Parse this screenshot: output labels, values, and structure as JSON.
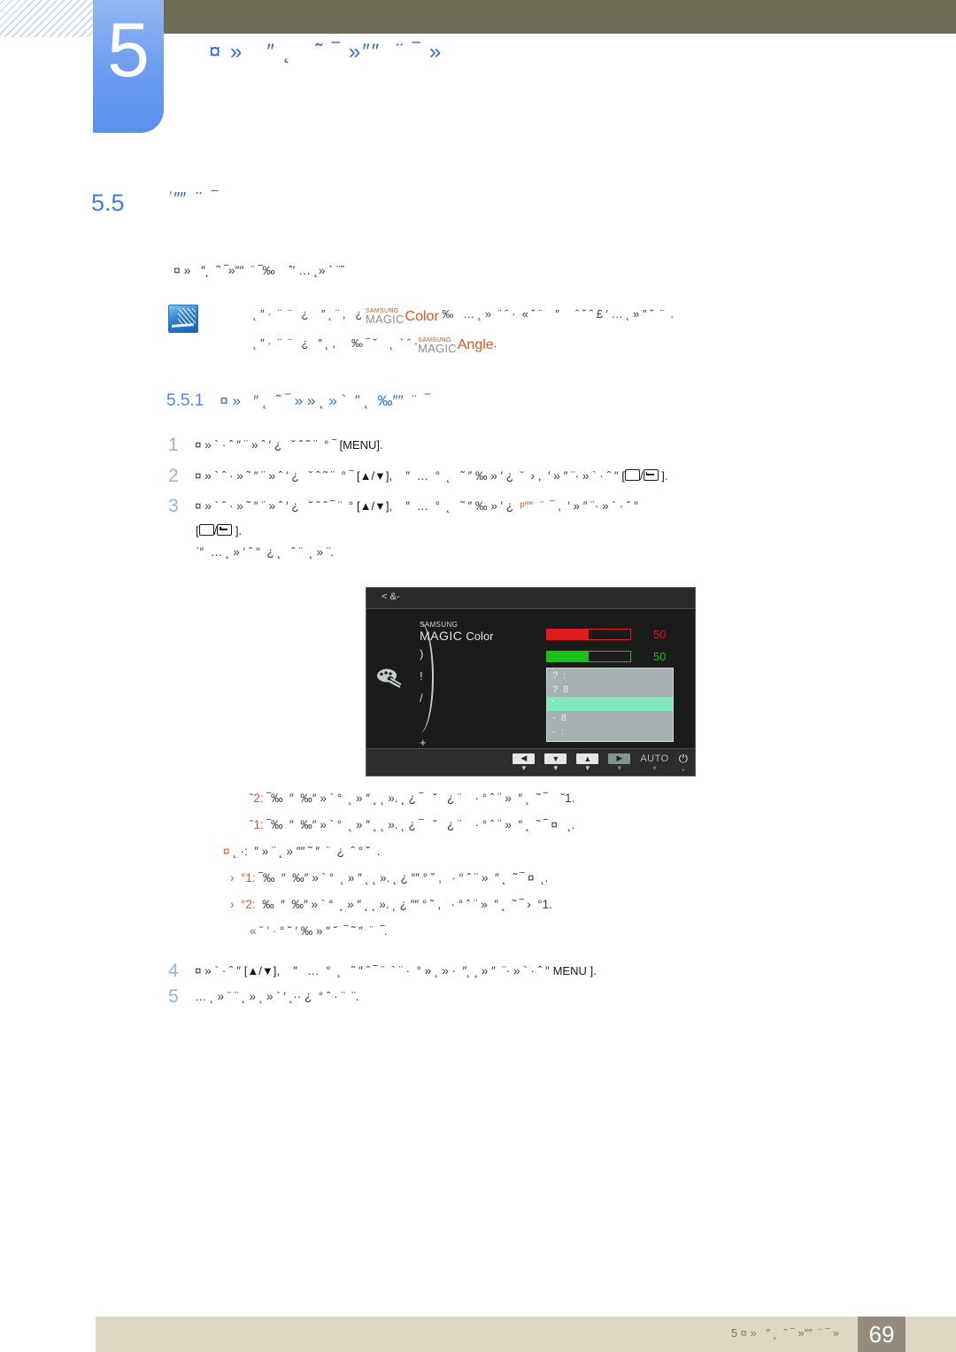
{
  "page": {
    "chapter_number": "5",
    "chapter_title": "¤ »   ″ ˛   ˜ ‾ »″″  ¨ ‾ »",
    "page_number": "69",
    "footer_text": "5 ¤ »   ″ ˛  ˜ ‾ »″″  ¨ ‾ »"
  },
  "section": {
    "number": "5.5",
    "title": "ˈ″″  ¨  ‾",
    "intro": "¤ »   ″˛  ˜ ‾»″″  ¨ ‾‰    ˆ′ … ˛» ` ¨ˆ"
  },
  "note": {
    "icon": "note-pencil-icon",
    "line1_pre": "˛ ″ ·  ¨  ¨   ¿    ″ ˛ ¨ ,   ¿ ",
    "line1_post": " ‰   … ˛ »  ¨ ˆ ·  « ˘ ¨    ″     ˆ ˘ ˆ £ ′ … ˛ » ″ ˘  ¨  .",
    "line2_pre": "˛ ″ ·  ¨  ¨   ¿   ″ ˛ ,     ‰ ‾ ˘    ˛  ` ˆ ·",
    "line2_post": ".",
    "logo1": {
      "top": "SAMSUNG",
      "bottom": "MAGIC",
      "word": "Color"
    },
    "logo2": {
      "top": "SAMSUNG",
      "bottom": "MAGIC",
      "word": "Angle"
    }
  },
  "subsection": {
    "number": "5.5.1",
    "title": "¤ »   ″ ˛  ˜ ‾ » » ˛ » `  ″ ˛  ‰″″  ¨  ‾"
  },
  "steps": [
    {
      "number": "1",
      "text_pre": "¤ » ` · ˆ ″ ¨ » ˆ ′ ¿   ˘ ˆ ˜ ¨  ° ‾ ",
      "key": "[MENU]",
      "text_post": "."
    },
    {
      "number": "2",
      "text_pre": "¤ » ` ˆ · » ˜ ″ ¨ » ˆ ′ ¿   ˘ ˆ ˜ ¨  ° ‾ ",
      "key1": "[▲/▼]",
      "text_mid": ",    ″  …  °  ˛   ˜ ″ ‰ » ′ ¿  ",
      "highlight": "˘",
      "text_mid2": "  › ,  ′ » ″ ¨· » ` · ˆ ″ ",
      "key2": "[▭/↵]",
      "text_post": "."
    },
    {
      "number": "3",
      "text_pre": "¤ » ` ˆ · » ˜ ″ ¨ » ˆ ′ ¿   ˘ ˆ ˆ ‾ ¨  ° ",
      "key1": "[▲/▼]",
      "text_mid": ",    ″  …  °  ˛   ˜ ″ ‰ » ′ ¿  ",
      "highlight": "ᵖ″″  ¨  ‾",
      "text_mid2": " ,  ′ » ″ ¨· » ` · ˆ ″",
      "key2": "[▭/↵]",
      "text_post": ".",
      "extra": "ˈ″  … ˛ » ′ ˆ ″  ¿ ˛   ˆ ¨  ˛ » ¨."
    },
    {
      "number": "4",
      "text_pre": "¤ » ` · ˆ ″ ",
      "key1": "[▲/▼]",
      "text_mid": ",    ″   …  °  ˛   ˜ ″ ˆ ‾ ¨  ` ¨ ·  ° » ˛ » ·  ″˛ ¸ » ″  ¨· » ` · ˆ ″ ",
      "key2": "MENU ]",
      "text_post": "."
    },
    {
      "number": "5",
      "text_pre": "… ˛ » ¨ ¨ ˛ » ˛ » ` ′ ˛·· ¿  ° ˆ · ¨  ¨."
    }
  ],
  "osd": {
    "titlebar": "< &-",
    "logo": {
      "top": "SAMSUNG",
      "bottom": "MAGIC",
      "word": "Color"
    },
    "menu_items": [
      ")",
      "!",
      "/",
      "+"
    ],
    "palette_icon": "palette-icon",
    "bars": [
      {
        "label": "red-bar",
        "value": "50",
        "percent": 50,
        "color": "#e01b1b"
      },
      {
        "label": "green-bar",
        "value": "50",
        "percent": 50,
        "color": "#18c018"
      }
    ],
    "dropdown_rows": [
      {
        "text": "?  :",
        "selected": false
      },
      {
        "text": "?  8",
        "selected": false
      },
      {
        "text": "'",
        "selected": true
      },
      {
        "text": "-  8",
        "selected": false
      },
      {
        "text": "-  :",
        "selected": false
      }
    ],
    "buttons": [
      {
        "name": "left-arrow-button",
        "glyph": "◀",
        "tick": "▼"
      },
      {
        "name": "down-arrow-button",
        "glyph": "▼",
        "tick": "▼"
      },
      {
        "name": "up-arrow-button",
        "glyph": "▲",
        "tick": "▼"
      },
      {
        "name": "right-arrow-button",
        "glyph": "▶",
        "tick": "▼"
      },
      {
        "name": "auto-button",
        "glyph": "AUTO",
        "tick": "▾"
      },
      {
        "name": "power-button",
        "glyph": "⏻",
        "tick": "▪"
      }
    ]
  },
  "bullets": [
    {
      "lead": "˘2:",
      "text": " ‾‰  ″  ‰″ » ` °  ˛ » ″ ˛ ˛ ». ˛ ¿ ‾   ˘   ¿ ¨    · ° ˆ ¨ »  ″ ˛  ˜ ‾    ˘1."
    },
    {
      "lead": "˘1:",
      "text": " ‾‰  ″  ‰″ » ` °  ˛ » ″ ˛ ˛ ». ˛ ¿ ‾   ˘   ¿ ¨    · ° ˆ ¨ »  ″ ˛  ˜ ‾ ¤   ˛."
    },
    {
      "lead": "¤",
      "text": " ˛ ·:  ″ » ¨ ˛ » ″″ ˜ ″  ¨  ¿  ˆ ° ˘  ."
    },
    {
      "lead": "›  °1:",
      "text": " ‾‰  ″  ‰″ » ` °  ˛ » ″ ˛ ˛ ». ˛ ¿ ″″ ° ˘ ,   · ° ˆ ¨ »  ″ ˛  ˜ ‾ ¤  ˛."
    },
    {
      "lead": "›  °2:",
      "text": "  ‰  ″  ‰″ » ` °  ˛ » ″ ˛ ˛ ». ˛ ¿ ″″ ° ˘ ,   · ° ˆ ¨ »  ″ ˛  ˜ ‾ ›  °1."
    },
    {
      "lead": "« ˘ ′ ·",
      "text": " ° ˘ ′ ‰ » ″ ˘  ‾ ˜ ″  ¨  ‾."
    }
  ]
}
